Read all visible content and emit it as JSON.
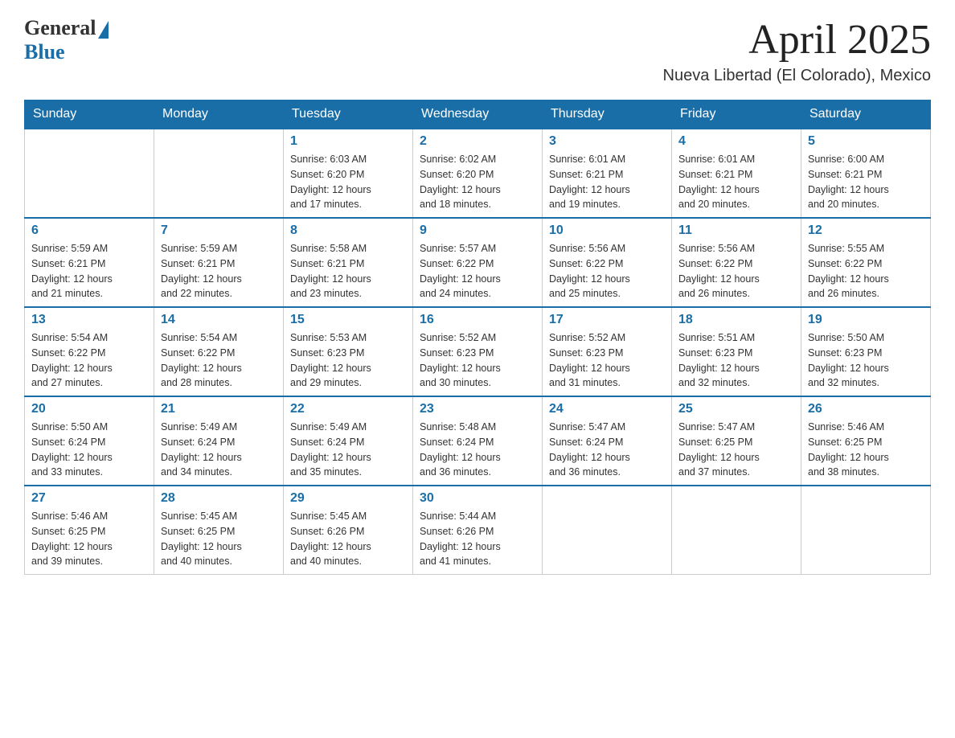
{
  "header": {
    "logo_general": "General",
    "logo_blue": "Blue",
    "month_year": "April 2025",
    "location": "Nueva Libertad (El Colorado), Mexico"
  },
  "weekdays": [
    "Sunday",
    "Monday",
    "Tuesday",
    "Wednesday",
    "Thursday",
    "Friday",
    "Saturday"
  ],
  "weeks": [
    [
      {
        "day": "",
        "info": ""
      },
      {
        "day": "",
        "info": ""
      },
      {
        "day": "1",
        "info": "Sunrise: 6:03 AM\nSunset: 6:20 PM\nDaylight: 12 hours\nand 17 minutes."
      },
      {
        "day": "2",
        "info": "Sunrise: 6:02 AM\nSunset: 6:20 PM\nDaylight: 12 hours\nand 18 minutes."
      },
      {
        "day": "3",
        "info": "Sunrise: 6:01 AM\nSunset: 6:21 PM\nDaylight: 12 hours\nand 19 minutes."
      },
      {
        "day": "4",
        "info": "Sunrise: 6:01 AM\nSunset: 6:21 PM\nDaylight: 12 hours\nand 20 minutes."
      },
      {
        "day": "5",
        "info": "Sunrise: 6:00 AM\nSunset: 6:21 PM\nDaylight: 12 hours\nand 20 minutes."
      }
    ],
    [
      {
        "day": "6",
        "info": "Sunrise: 5:59 AM\nSunset: 6:21 PM\nDaylight: 12 hours\nand 21 minutes."
      },
      {
        "day": "7",
        "info": "Sunrise: 5:59 AM\nSunset: 6:21 PM\nDaylight: 12 hours\nand 22 minutes."
      },
      {
        "day": "8",
        "info": "Sunrise: 5:58 AM\nSunset: 6:21 PM\nDaylight: 12 hours\nand 23 minutes."
      },
      {
        "day": "9",
        "info": "Sunrise: 5:57 AM\nSunset: 6:22 PM\nDaylight: 12 hours\nand 24 minutes."
      },
      {
        "day": "10",
        "info": "Sunrise: 5:56 AM\nSunset: 6:22 PM\nDaylight: 12 hours\nand 25 minutes."
      },
      {
        "day": "11",
        "info": "Sunrise: 5:56 AM\nSunset: 6:22 PM\nDaylight: 12 hours\nand 26 minutes."
      },
      {
        "day": "12",
        "info": "Sunrise: 5:55 AM\nSunset: 6:22 PM\nDaylight: 12 hours\nand 26 minutes."
      }
    ],
    [
      {
        "day": "13",
        "info": "Sunrise: 5:54 AM\nSunset: 6:22 PM\nDaylight: 12 hours\nand 27 minutes."
      },
      {
        "day": "14",
        "info": "Sunrise: 5:54 AM\nSunset: 6:22 PM\nDaylight: 12 hours\nand 28 minutes."
      },
      {
        "day": "15",
        "info": "Sunrise: 5:53 AM\nSunset: 6:23 PM\nDaylight: 12 hours\nand 29 minutes."
      },
      {
        "day": "16",
        "info": "Sunrise: 5:52 AM\nSunset: 6:23 PM\nDaylight: 12 hours\nand 30 minutes."
      },
      {
        "day": "17",
        "info": "Sunrise: 5:52 AM\nSunset: 6:23 PM\nDaylight: 12 hours\nand 31 minutes."
      },
      {
        "day": "18",
        "info": "Sunrise: 5:51 AM\nSunset: 6:23 PM\nDaylight: 12 hours\nand 32 minutes."
      },
      {
        "day": "19",
        "info": "Sunrise: 5:50 AM\nSunset: 6:23 PM\nDaylight: 12 hours\nand 32 minutes."
      }
    ],
    [
      {
        "day": "20",
        "info": "Sunrise: 5:50 AM\nSunset: 6:24 PM\nDaylight: 12 hours\nand 33 minutes."
      },
      {
        "day": "21",
        "info": "Sunrise: 5:49 AM\nSunset: 6:24 PM\nDaylight: 12 hours\nand 34 minutes."
      },
      {
        "day": "22",
        "info": "Sunrise: 5:49 AM\nSunset: 6:24 PM\nDaylight: 12 hours\nand 35 minutes."
      },
      {
        "day": "23",
        "info": "Sunrise: 5:48 AM\nSunset: 6:24 PM\nDaylight: 12 hours\nand 36 minutes."
      },
      {
        "day": "24",
        "info": "Sunrise: 5:47 AM\nSunset: 6:24 PM\nDaylight: 12 hours\nand 36 minutes."
      },
      {
        "day": "25",
        "info": "Sunrise: 5:47 AM\nSunset: 6:25 PM\nDaylight: 12 hours\nand 37 minutes."
      },
      {
        "day": "26",
        "info": "Sunrise: 5:46 AM\nSunset: 6:25 PM\nDaylight: 12 hours\nand 38 minutes."
      }
    ],
    [
      {
        "day": "27",
        "info": "Sunrise: 5:46 AM\nSunset: 6:25 PM\nDaylight: 12 hours\nand 39 minutes."
      },
      {
        "day": "28",
        "info": "Sunrise: 5:45 AM\nSunset: 6:25 PM\nDaylight: 12 hours\nand 40 minutes."
      },
      {
        "day": "29",
        "info": "Sunrise: 5:45 AM\nSunset: 6:26 PM\nDaylight: 12 hours\nand 40 minutes."
      },
      {
        "day": "30",
        "info": "Sunrise: 5:44 AM\nSunset: 6:26 PM\nDaylight: 12 hours\nand 41 minutes."
      },
      {
        "day": "",
        "info": ""
      },
      {
        "day": "",
        "info": ""
      },
      {
        "day": "",
        "info": ""
      }
    ]
  ]
}
